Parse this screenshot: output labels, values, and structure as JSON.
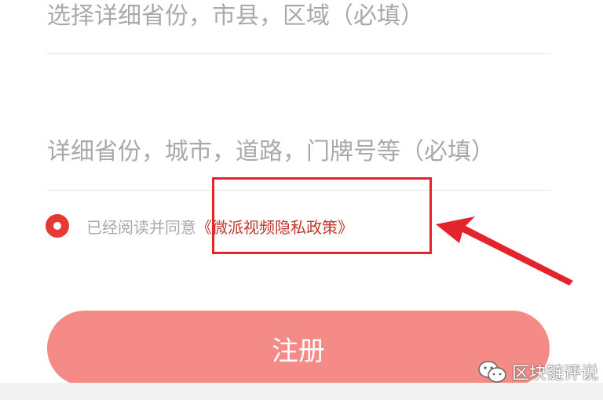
{
  "form": {
    "region_placeholder": "选择详细省份，市县，区域（必填）",
    "address_placeholder": "详细省份，城市，道路，门牌号等（必填）"
  },
  "agreement": {
    "prefix_text": "已经阅读并同意",
    "policy_link": "《微派视频隐私政策》",
    "checked": true
  },
  "register_button": {
    "label": "注册"
  },
  "annotation": {
    "box_color": "#e3242b",
    "arrow_color": "#e3242b"
  },
  "watermark": {
    "icon": "wechat-icon",
    "text": "区块链评说"
  },
  "colors": {
    "accent_red": "#e53935",
    "button_bg": "#f58b86",
    "link_color": "#c0392b"
  }
}
